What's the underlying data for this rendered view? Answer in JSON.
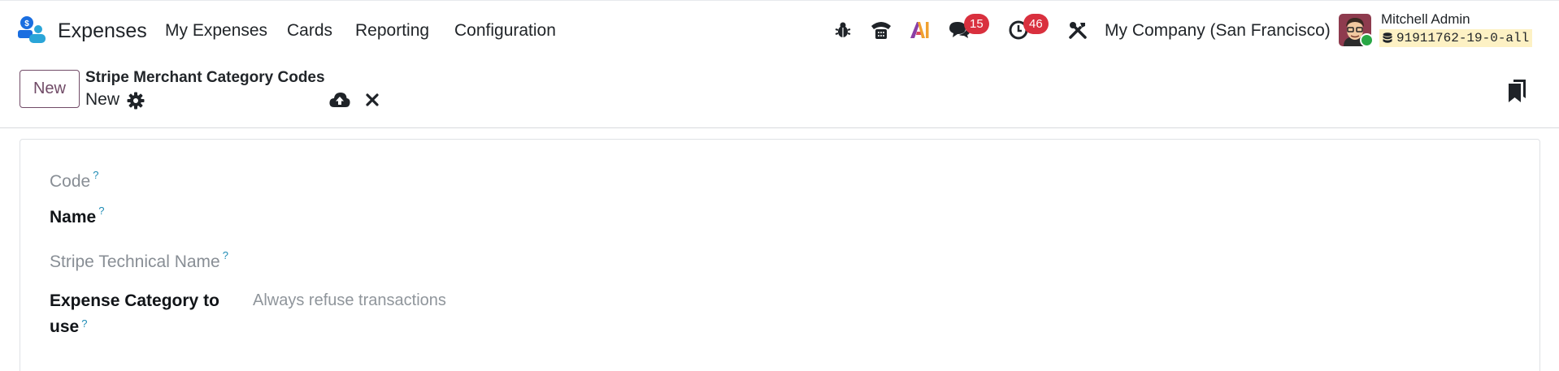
{
  "navbar": {
    "app_name": "Expenses",
    "menu": [
      {
        "label": "My Expenses"
      },
      {
        "label": "Cards"
      },
      {
        "label": "Reporting"
      },
      {
        "label": "Configuration"
      }
    ],
    "messages_badge": "15",
    "activities_badge": "46",
    "company": "My Company (San Francisco)",
    "user_name": "Mitchell Admin",
    "database": "91911762-19-0-all"
  },
  "control_panel": {
    "new_button": "New",
    "breadcrumb_parent": "Stripe Merchant Category Codes",
    "breadcrumb_current": "New"
  },
  "form": {
    "code_label": "Code",
    "name_label": "Name",
    "stripe_technical_name_label": "Stripe Technical Name",
    "expense_category_label_line1": "Expense Category to",
    "expense_category_label_line2": "use",
    "expense_category_placeholder": "Always refuse transactions",
    "help_marker": "?"
  },
  "icons": [
    "expenses-app-icon",
    "bug-icon",
    "phone-icon",
    "ai-icon",
    "chat-icon",
    "clock-icon",
    "tools-icon",
    "gear-icon",
    "cloud-upload-icon",
    "close-icon",
    "bookmarks-icon",
    "database-icon"
  ],
  "colors": {
    "brand": "#714b67",
    "badge": "#d9303e",
    "help": "#1e8bb5",
    "db_chip_bg": "#fdf1c4",
    "presence": "#28a745"
  }
}
